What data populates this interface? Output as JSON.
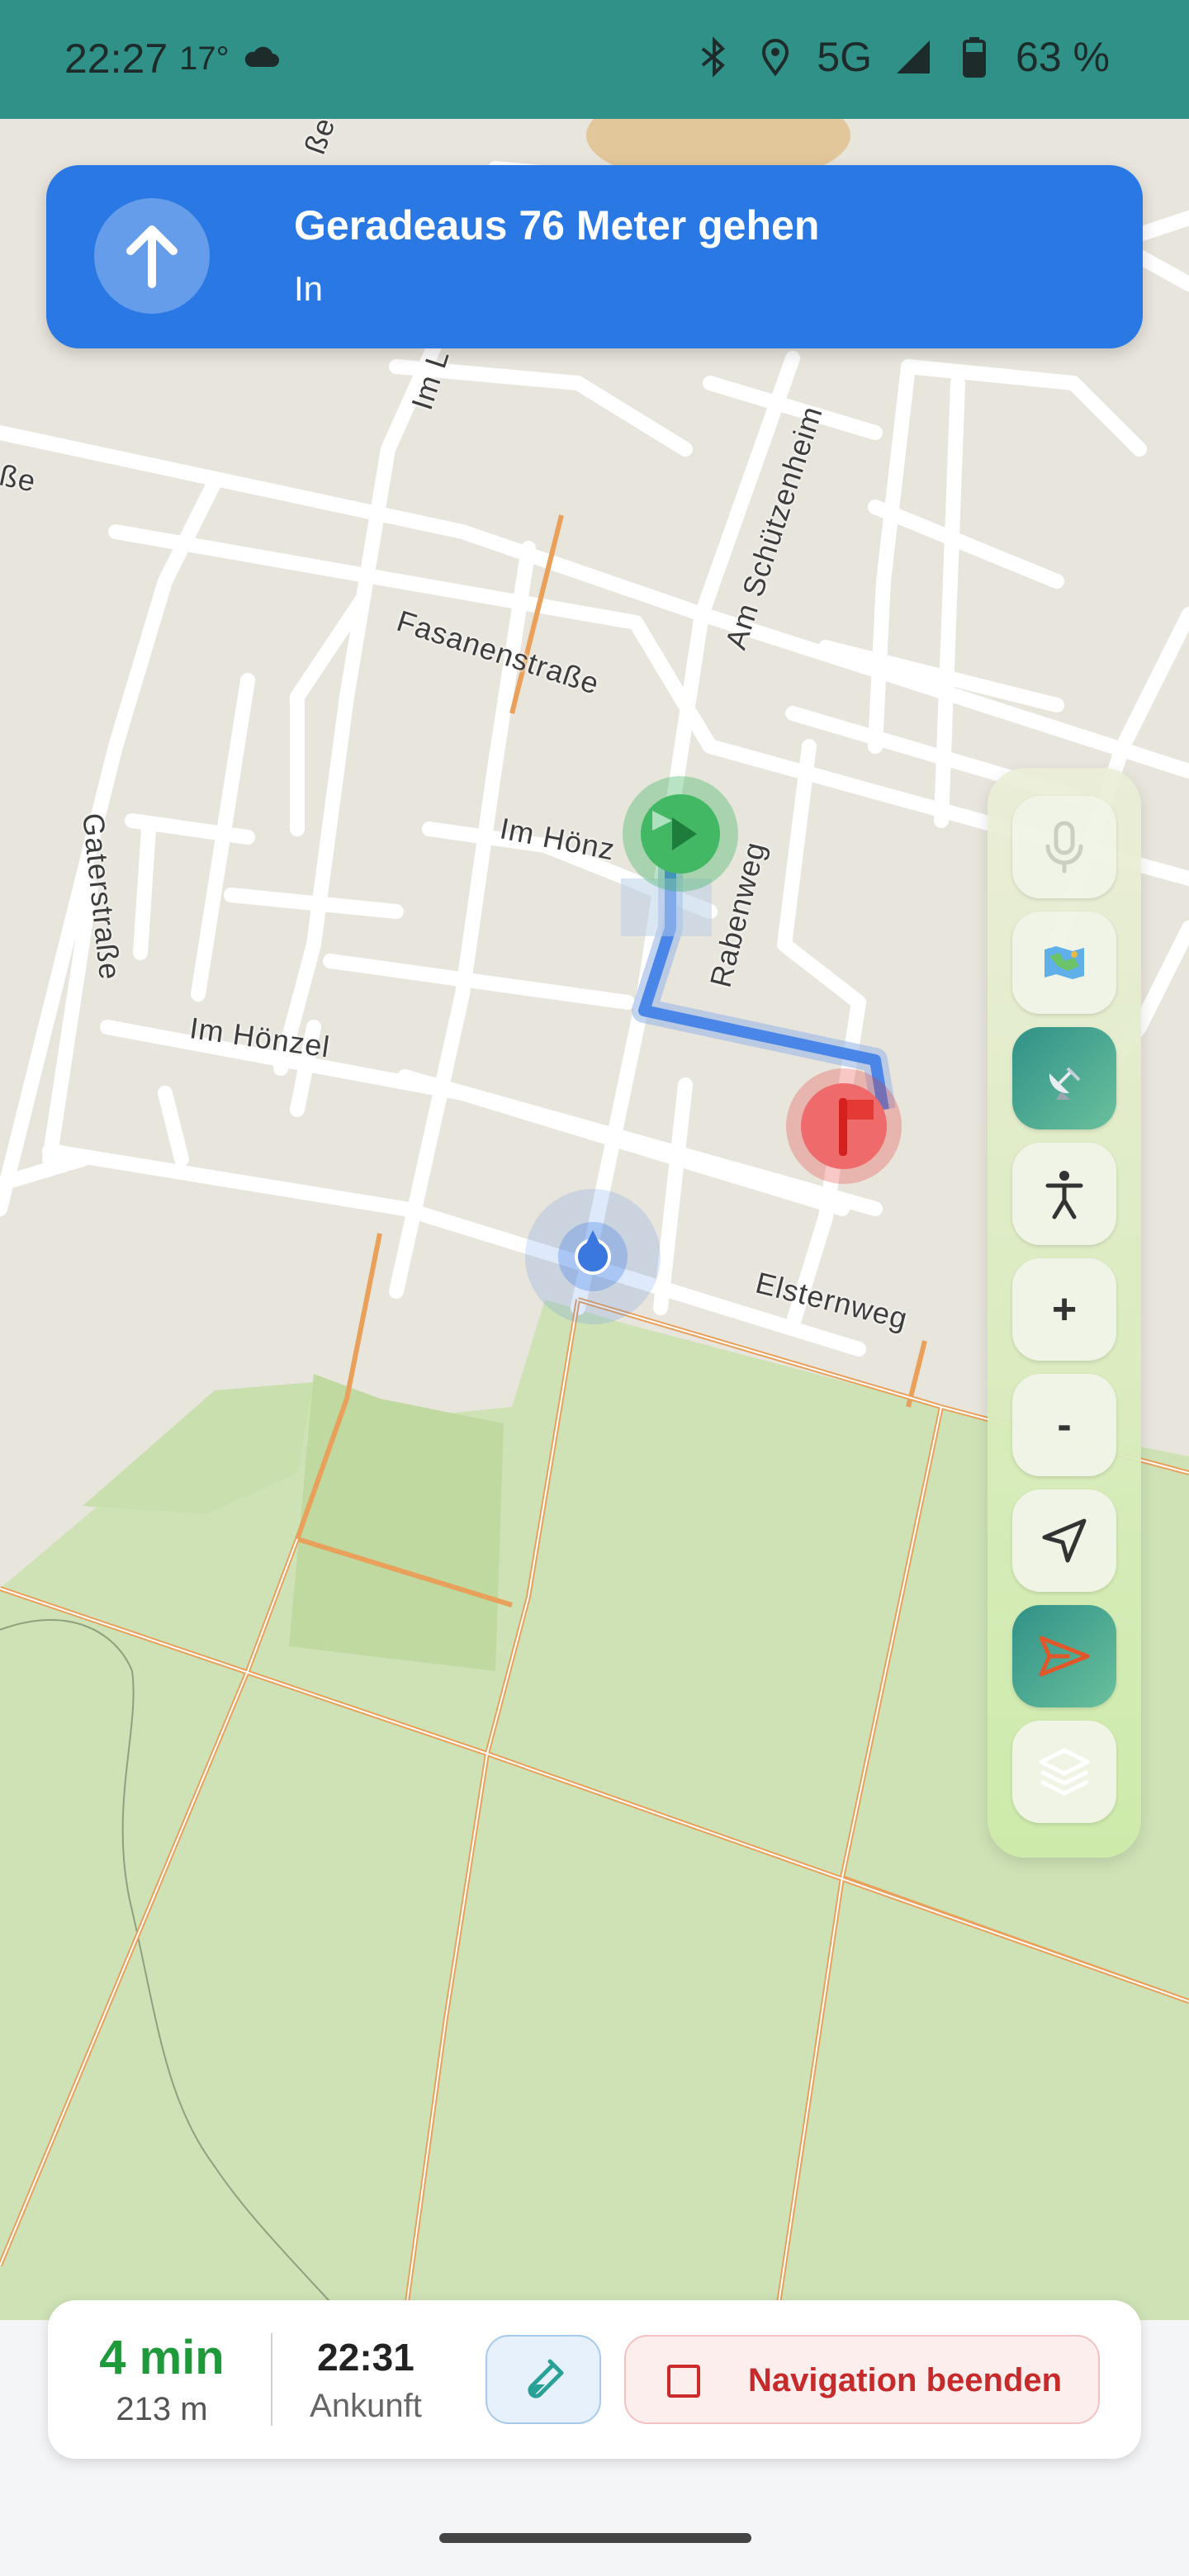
{
  "status_bar": {
    "time": "22:27",
    "temperature": "17°",
    "network": "5G",
    "battery": "63 %",
    "icons": [
      "cloud-icon",
      "bluetooth-icon",
      "location-icon",
      "signal-icon",
      "battery-icon"
    ]
  },
  "navigation": {
    "instruction": "Geradeaus 76 Meter gehen",
    "street": "In",
    "maneuver_icon": "arrow-up-icon"
  },
  "map": {
    "street_labels": {
      "strasse_top": "ße",
      "im_l": "Im L",
      "strasse_left": "ße",
      "am_schuetzenheim": "Am Schützenheim",
      "fasanenstrasse": "Fasanenstraße",
      "im_hoenz": "Im Hönz",
      "rabenweg": "Rabenweg",
      "gaterstrasse": "Gaterstraße",
      "im_hoenzel": "Im Hönzel",
      "elsternweg": "Elsternweg"
    },
    "markers": [
      "start-marker",
      "destination-flag",
      "current-location"
    ],
    "colors": {
      "route": "#4a86e8",
      "start": "#34b35a",
      "destination": "#e53935",
      "forest": "#c9dfb0",
      "paths": "#e59a4a"
    }
  },
  "controls": {
    "buttons": [
      {
        "name": "microphone-button",
        "icon": "microphone-icon",
        "label": ""
      },
      {
        "name": "map-style-button",
        "icon": "map-icon",
        "label": ""
      },
      {
        "name": "satellite-button",
        "icon": "satellite-icon",
        "label": ""
      },
      {
        "name": "walking-mode-button",
        "icon": "person-icon",
        "label": ""
      },
      {
        "name": "zoom-in-button",
        "icon": "plus-icon",
        "label": "+"
      },
      {
        "name": "zoom-out-button",
        "icon": "minus-icon",
        "label": "-"
      },
      {
        "name": "locate-button",
        "icon": "navigation-arrow-icon",
        "label": ""
      },
      {
        "name": "navigate-button",
        "icon": "send-icon",
        "label": ""
      },
      {
        "name": "layers-button",
        "icon": "layers-icon",
        "label": ""
      }
    ]
  },
  "bottom": {
    "duration": "4 min",
    "distance": "213 m",
    "arrival_time": "22:31",
    "arrival_label": "Ankunft",
    "test_icon": "test-tube-icon",
    "end_label": "Navigation beenden"
  }
}
